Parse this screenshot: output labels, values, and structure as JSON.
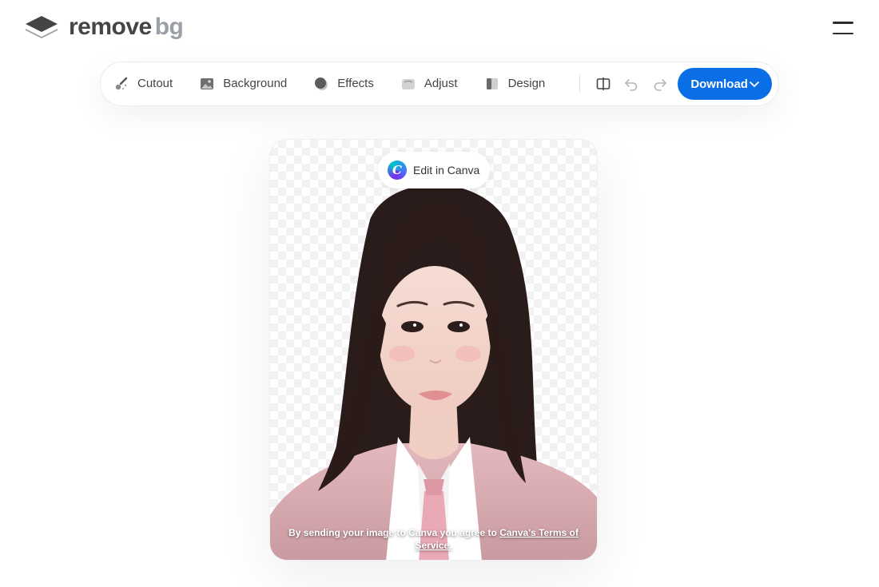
{
  "header": {
    "logo_primary": "remove",
    "logo_secondary": "bg",
    "menu_icon": "hamburger-menu-icon"
  },
  "toolbar": {
    "tools": [
      {
        "label": "Cutout",
        "icon": "brush-icon"
      },
      {
        "label": "Background",
        "icon": "image-icon"
      },
      {
        "label": "Effects",
        "icon": "effects-circle-icon"
      },
      {
        "label": "Adjust",
        "icon": "adjust-icon"
      },
      {
        "label": "Design",
        "icon": "layout-icon"
      }
    ],
    "compare_icon": "compare-split-icon",
    "undo_icon": "undo-icon",
    "redo_icon": "redo-icon",
    "download_label": "Download"
  },
  "card": {
    "canva_button_label": "Edit in Canva",
    "terms_prefix": "By sending your image to Canva you agree to ",
    "terms_link": "Canva's Terms of Service."
  },
  "colors": {
    "accent": "#0a6ee6",
    "text": "#454545",
    "logo_secondary": "#9aa0a6"
  }
}
